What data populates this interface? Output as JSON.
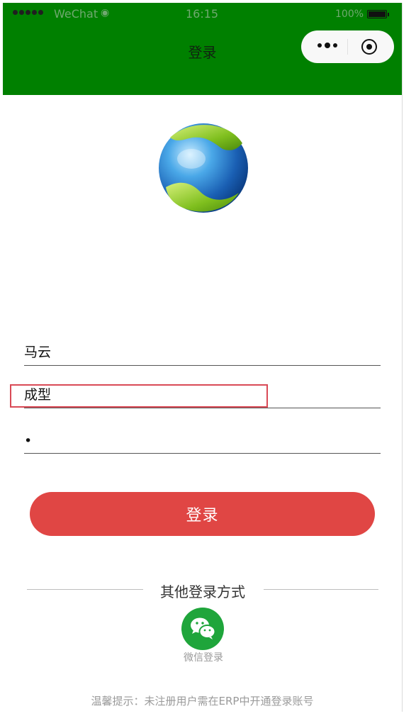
{
  "status_bar": {
    "carrier": "WeChat",
    "time": "16:15",
    "battery": "100%"
  },
  "navbar": {
    "title": "登录"
  },
  "form": {
    "username_value": "马云",
    "company_value": "成型",
    "password_value": "•"
  },
  "login_button": {
    "label": "登录"
  },
  "other_login": {
    "heading": "其他登录方式",
    "wechat_label": "微信登录"
  },
  "tip": "温馨提示：未注册用户需在ERP中开通登录账号",
  "colors": {
    "navbar": "#008000",
    "login_button": "#e04644",
    "wechat": "#1fa53b",
    "highlight": "#d94a56"
  },
  "icons": {
    "logo": "globe-logo-icon",
    "wechat": "wechat-icon",
    "menu": "more-dots-icon",
    "close": "close-target-icon"
  }
}
